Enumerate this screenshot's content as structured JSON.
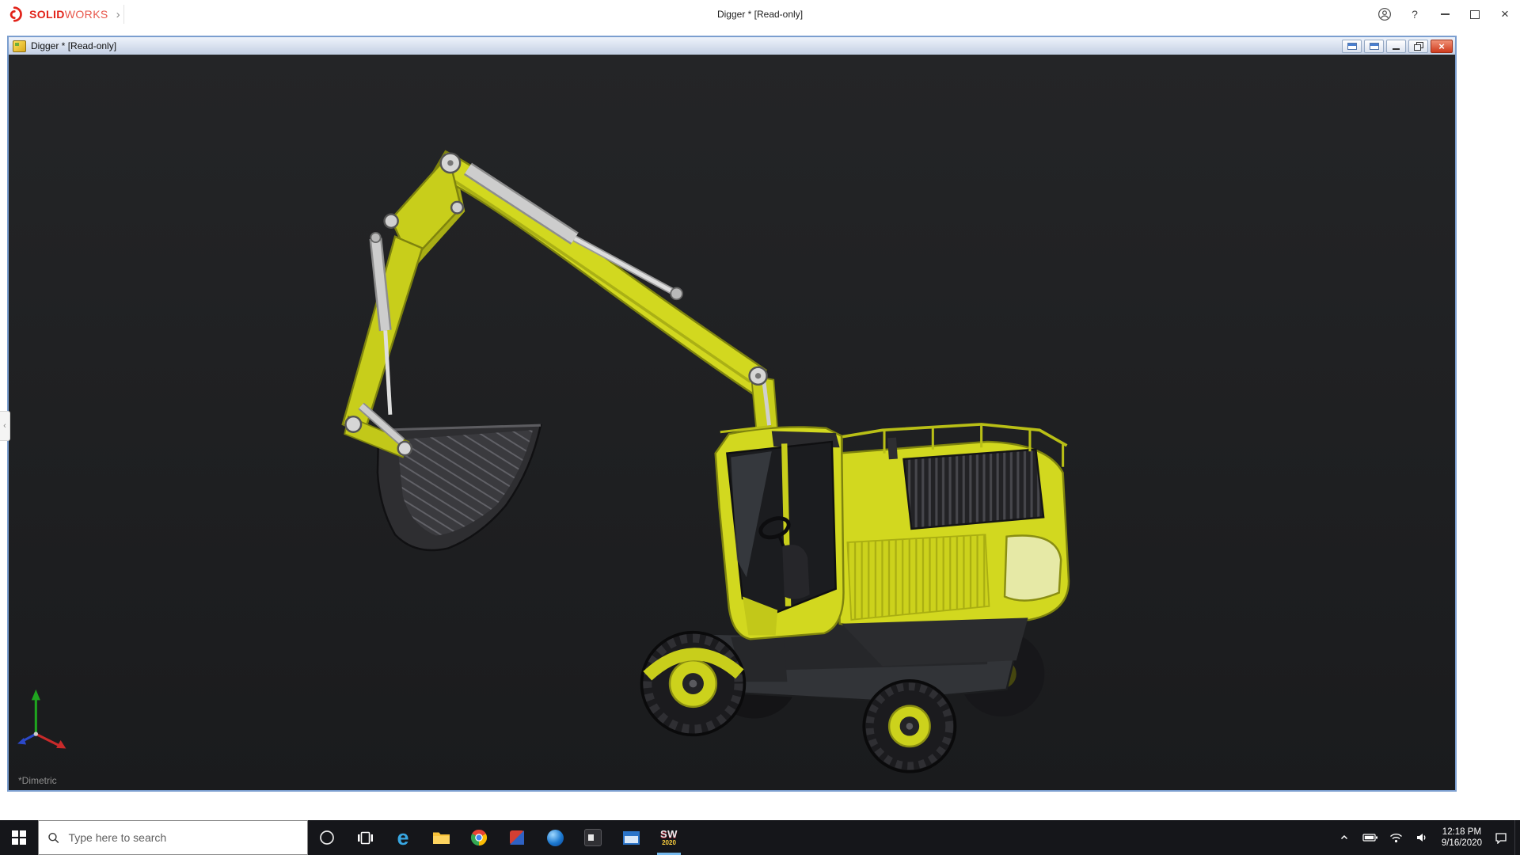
{
  "app_titlebar": {
    "brand_solid": "SOLID",
    "brand_works": "WORKS",
    "menu_arrow": "›",
    "title": "Digger * [Read-only]",
    "help_glyph": "?",
    "close_glyph": "×"
  },
  "document_window": {
    "title": "Digger * [Read-only]",
    "close_glyph": "×"
  },
  "workspace": {
    "panel_arrow": "‹"
  },
  "viewport": {
    "orientation": "*Dimetric"
  },
  "taskbar": {
    "search_text": "Type here to search",
    "edge_glyph": "e",
    "sw_line1": "SW",
    "sw_line2": "2020",
    "tray": {
      "time": "12:18 PM",
      "date": "9/16/2020"
    }
  },
  "colors": {
    "brand_red": "#e2231a",
    "excavator_yellow": "#d2d81f",
    "viewport_bg": "#1d1e20",
    "taskbar_bg": "#15161a",
    "doc_titlebar_from": "#eef3fb",
    "doc_titlebar_to": "#c3cfe3",
    "doc_close_red": "#cf3b1e",
    "doc_border_blue": "#7b9ecf"
  }
}
